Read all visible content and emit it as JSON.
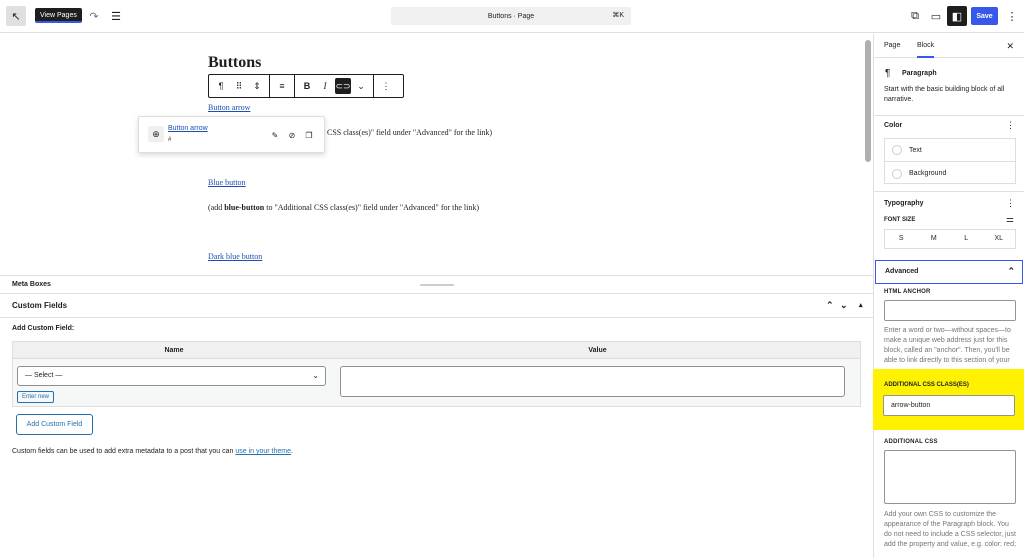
{
  "topbar": {
    "tooltip": "View Pages",
    "document_title": "Buttons · Page",
    "shortcut": "⌘K",
    "save_label": "Save",
    "icons": [
      "back-arrow-icon",
      "redo-icon",
      "list-view-icon",
      "view-external-icon",
      "preview-desktop-icon",
      "settings-sidebar-icon",
      "more-options-icon"
    ]
  },
  "editor": {
    "title": "Buttons",
    "link_button_arrow": "Button arrow",
    "partial_line": "CSS class(es)\" field under \"Advanced\" for the link)",
    "link_blue_button": "Blue button",
    "line2_prefix": "(add ",
    "line2_bold": "blue-button",
    "line2_suffix": " to \"Additional CSS class(es)\" field under \"Advanced\" for the link)",
    "link_dark_blue": "Dark blue button",
    "link_popover": {
      "link_text": "Button arrow",
      "url": "#"
    }
  },
  "metabox": {
    "header": "Meta Boxes",
    "custom_fields_title": "Custom Fields",
    "add_label": "Add Custom Field:",
    "col_name": "Name",
    "col_value": "Value",
    "select_value": "— Select —",
    "enter_new": "Enter new",
    "add_button": "Add Custom Field",
    "note_prefix": "Custom fields can be used to add extra metadata to a post that you can ",
    "note_link": "use in your theme",
    "note_suffix": "."
  },
  "sidebar": {
    "tab_page": "Page",
    "tab_block": "Block",
    "block_name": "Paragraph",
    "block_desc": "Start with the basic building block of all narrative.",
    "color_title": "Color",
    "color_text": "Text",
    "color_background": "Background",
    "typography_title": "Typography",
    "font_size_label": "FONT SIZE",
    "font_sizes": [
      "S",
      "M",
      "L",
      "XL"
    ],
    "advanced_title": "Advanced",
    "html_anchor_label": "HTML ANCHOR",
    "html_anchor_value": "",
    "html_anchor_help": "Enter a word or two—without spaces—to make a unique web address just for this block, called an \"anchor\". Then, you'll be able to link directly to this section of your",
    "css_class_label": "ADDITIONAL CSS CLASS(ES)",
    "css_class_value": "arrow-button",
    "additional_css_label": "ADDITIONAL CSS",
    "additional_css_help": "Add your own CSS to customize the appearance of the Paragraph block. You do not need to include a CSS selector, just add the property and value, e.g. color: red;",
    "highlight_color": "#fff200"
  }
}
